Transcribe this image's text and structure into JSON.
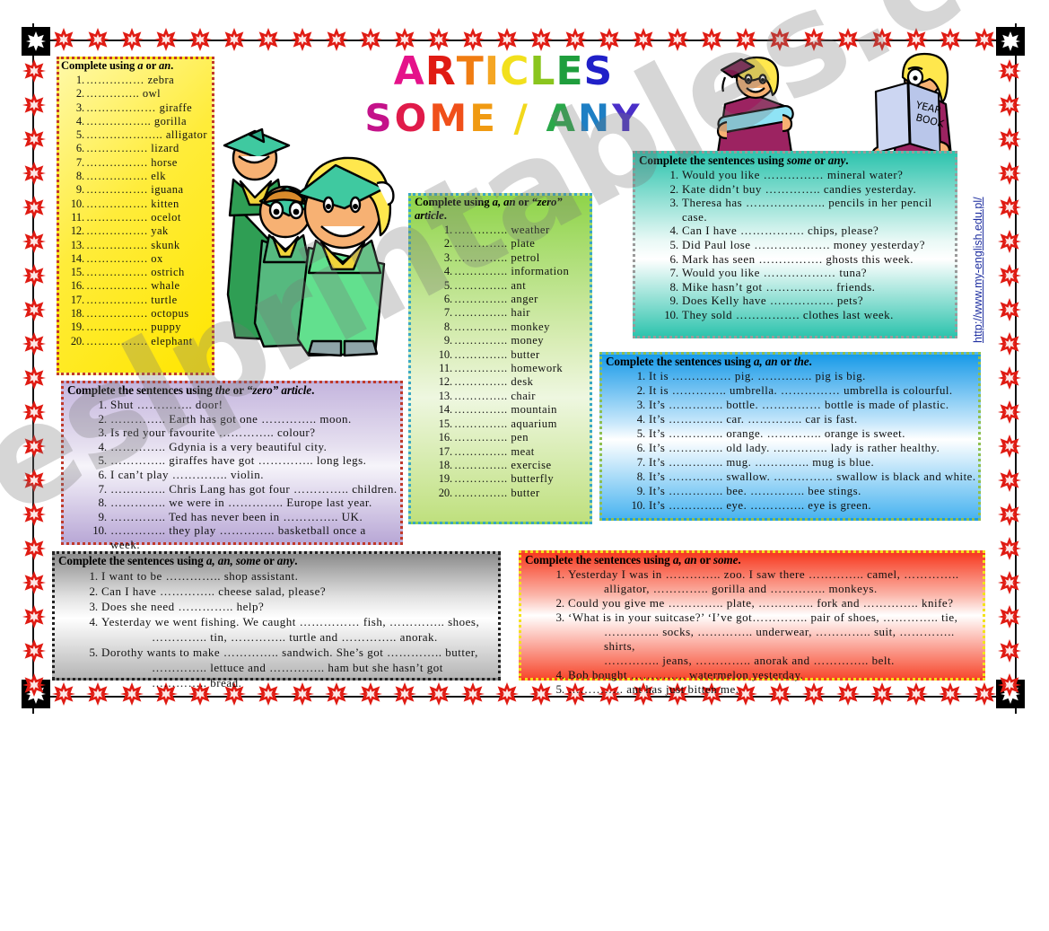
{
  "title": {
    "line1": [
      {
        "ch": "A",
        "color": "#e5128a"
      },
      {
        "ch": "R",
        "color": "#e01b13"
      },
      {
        "ch": "T",
        "color": "#f07c12"
      },
      {
        "ch": "I",
        "color": "#f5a623"
      },
      {
        "ch": "C",
        "color": "#f2e01c"
      },
      {
        "ch": "L",
        "color": "#8ac51e"
      },
      {
        "ch": "E",
        "color": "#1f9e3d"
      },
      {
        "ch": "S",
        "color": "#2020c8"
      }
    ],
    "line2": [
      {
        "ch": "S",
        "color": "#c4128a"
      },
      {
        "ch": "O",
        "color": "#e01b4a"
      },
      {
        "ch": "M",
        "color": "#f0501a"
      },
      {
        "ch": "E",
        "color": "#f09a12"
      },
      {
        "ch": " ",
        "color": "#ffffff"
      },
      {
        "ch": "/",
        "color": "#f2d81c"
      },
      {
        "ch": " ",
        "color": "#ffffff"
      },
      {
        "ch": "A",
        "color": "#2aa84a"
      },
      {
        "ch": "N",
        "color": "#1e7fc4"
      },
      {
        "ch": "Y",
        "color": "#4a2fc8"
      }
    ],
    "plain1": "ARTICLES",
    "plain2": "SOME / ANY"
  },
  "url": "http://www.my-english.edu.pl/",
  "watermark": "eslprintables.com",
  "box_aan": {
    "heading_pre": "Complete using ",
    "heading_em1": "a",
    "heading_mid": " or ",
    "heading_em2": "an",
    "heading_post": ".",
    "items": [
      "…………… zebra",
      "………….. owl",
      "……………… giraffe",
      "…………….. gorilla",
      "……………….. alligator",
      "……………. lizard",
      "……………. horse",
      "……………. elk",
      "……………. iguana",
      "……………. kitten",
      "……………. ocelot",
      "……………. yak",
      "……………. skunk",
      "……………. ox",
      "……………. ostrich",
      "……………. whale",
      "……………. turtle",
      "……………. octopus",
      "……………. puppy",
      "……………. elephant"
    ]
  },
  "box_zero": {
    "heading_pre": "Complete using ",
    "heading_em1": "a, an",
    "heading_mid": " or ",
    "heading_em2": "“zero” article",
    "heading_post": ".",
    "items": [
      "………….. weather",
      "………….. plate",
      "………….. petrol",
      "………….. information",
      "………….. ant",
      "………….. anger",
      "………….. hair",
      "………….. monkey",
      "………….. money",
      "………….. butter",
      "………….. homework",
      "………….. desk",
      "………….. chair",
      "………….. mountain",
      "………….. aquarium",
      "………….. pen",
      "………….. meat",
      "………….. exercise",
      "………….. butterfly",
      "………….. butter"
    ]
  },
  "box_someany": {
    "heading_pre": "Complete the sentences using ",
    "heading_em1": "some",
    "heading_mid": " or ",
    "heading_em2": "any",
    "heading_post": ".",
    "items": [
      "Would you like …………… mineral water?",
      "Kate didn’t buy ………….. candies yesterday.",
      "Theresa has ……………….. pencils in her pencil case.",
      "Can I have ……………. chips, please?",
      "Did Paul lose ………………. money yesterday?",
      "Mark has seen ……………. ghosts this week.",
      "Would you like ……………… tuna?",
      "Mike hasn’t got …………….. friends.",
      "Does Kelly have ……………. pets?",
      "They sold ……………. clothes last week."
    ]
  },
  "box_aanthe": {
    "heading_pre": "Complete the sentences using ",
    "heading_em1": "a, an",
    "heading_mid": " or ",
    "heading_em2": "the",
    "heading_post": ".",
    "items": [
      "It is …………… pig. ………….. pig is big.",
      "It is ………….. umbrella. …………… umbrella is colourful.",
      "It’s ………….. bottle. …………… bottle is made of plastic.",
      "It’s ………….. car. ………….. car is fast.",
      "It’s ………….. orange. ………….. orange is sweet.",
      "It’s ………….. old lady. ………….. lady is rather healthy.",
      "It’s ………….. mug. ………….. mug is blue.",
      "It’s ………….. swallow. …………… swallow is black and white.",
      "It’s ………….. bee. ………….. bee stings.",
      "It’s ………….. eye. ………….. eye is green."
    ]
  },
  "box_thezero": {
    "heading_pre": "Complete the sentences using ",
    "heading_em1": "the",
    "heading_mid": " or ",
    "heading_em2": "“zero” article",
    "heading_post": ".",
    "items": [
      "Shut ………….. door!",
      "………….. Earth has got one ………….. moon.",
      "Is red your favourite ………….. colour?",
      "………….. Gdynia is a very beautiful city.",
      "………….. giraffes have got ………….. long legs.",
      "I can’t play ………….. violin.",
      "………….. Chris Lang has got four ………….. children.",
      "………….. we were in ………….. Europe last year.",
      "………….. Ted has never been in ………….. UK.",
      "………….. they play ………….. basketball once a week."
    ]
  },
  "box_aansomeany": {
    "heading_pre": "Complete the sentences using ",
    "heading_em1": "a, an, some",
    "heading_mid": " or ",
    "heading_em2": "any",
    "heading_post": ".",
    "items": [
      {
        "main": "I want to be ………….. shop assistant.",
        "cont": ""
      },
      {
        "main": "Can I have ………….. cheese salad, please?",
        "cont": ""
      },
      {
        "main": "Does she need ………….. help?",
        "cont": ""
      },
      {
        "main": "Yesterday we went fishing. We caught …………… fish, ………….. shoes,",
        "cont": "………….. tin, ………….. turtle and ………….. anorak."
      },
      {
        "main": "Dorothy wants to make ………….. sandwich. She’s got ………….. butter,",
        "cont": "………….. lettuce and ………….. ham but she hasn’t got ………….. bread."
      }
    ]
  },
  "box_aansome": {
    "heading_pre": "Complete the sentences using ",
    "heading_em1": "a, an",
    "heading_mid": " or ",
    "heading_em2": "some",
    "heading_post": ".",
    "items": [
      {
        "main": "Yesterday I was in ………….. zoo. I saw there ………….. camel, …………..",
        "cont": "alligator, ………….. gorilla and ………….. monkeys.",
        "cont2": ""
      },
      {
        "main": "Could you give me ………….. plate, ………….. fork and ………….. knife?",
        "cont": "",
        "cont2": ""
      },
      {
        "main": "‘What is in your suitcase?’ ‘I’ve got………….. pair of shoes, ………….. tie,",
        "cont": "………….. socks, ………….. underwear, ………….. suit, ………….. shirts,",
        "cont2": "………….. jeans, ………….. anorak and ………….. belt."
      },
      {
        "main": "Bob bought ………….. watermelon yesterday.",
        "cont": "",
        "cont2": ""
      },
      {
        "main": "………….. ant has just bitten me.",
        "cont": "",
        "cont2": ""
      }
    ]
  },
  "clipart": {
    "graduates": "three-graduates-green-gowns",
    "girl_diploma": "girl-with-diploma-maroon-gown",
    "girl_yearbook": "girl-reading-yearbook",
    "yearbook_label": "YEAR BOOK"
  },
  "colors": {
    "border_star": "#e01b13",
    "yellow_box": "#ffe600",
    "green_box": "#8fd44a",
    "teal_box": "#2fc4ae",
    "blue_box": "#189ae8",
    "purple_box": "#c5b6de",
    "gray_box": "#8c8c8c",
    "red_box": "#f73a20",
    "url_color": "#1f2fa0"
  }
}
